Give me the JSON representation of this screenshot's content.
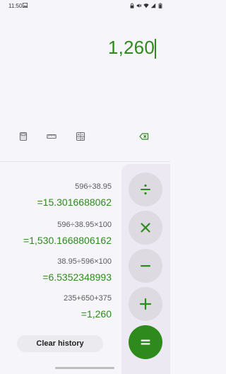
{
  "status_bar": {
    "time": "11:50"
  },
  "display": {
    "value": "1,260"
  },
  "tools": {
    "calculator": "calculator-icon",
    "ruler": "ruler-icon",
    "scientific": "grid-icon",
    "backspace": "backspace-icon"
  },
  "history": [
    {
      "expr": "596÷38.95",
      "res": "=15.3016688062"
    },
    {
      "expr": "596÷38.95×100",
      "res": "=1,530.1668806162"
    },
    {
      "expr": "38.95÷596×100",
      "res": "=6.5352348993"
    },
    {
      "expr": "235+650+375",
      "res": "=1,260"
    }
  ],
  "clear_history_label": "Clear history",
  "operators": [
    "divide",
    "multiply",
    "minus",
    "plus",
    "equals"
  ],
  "colors": {
    "accent": "#2f8a1e",
    "background": "#f6f5fa",
    "op_bg": "#dddbe1"
  }
}
